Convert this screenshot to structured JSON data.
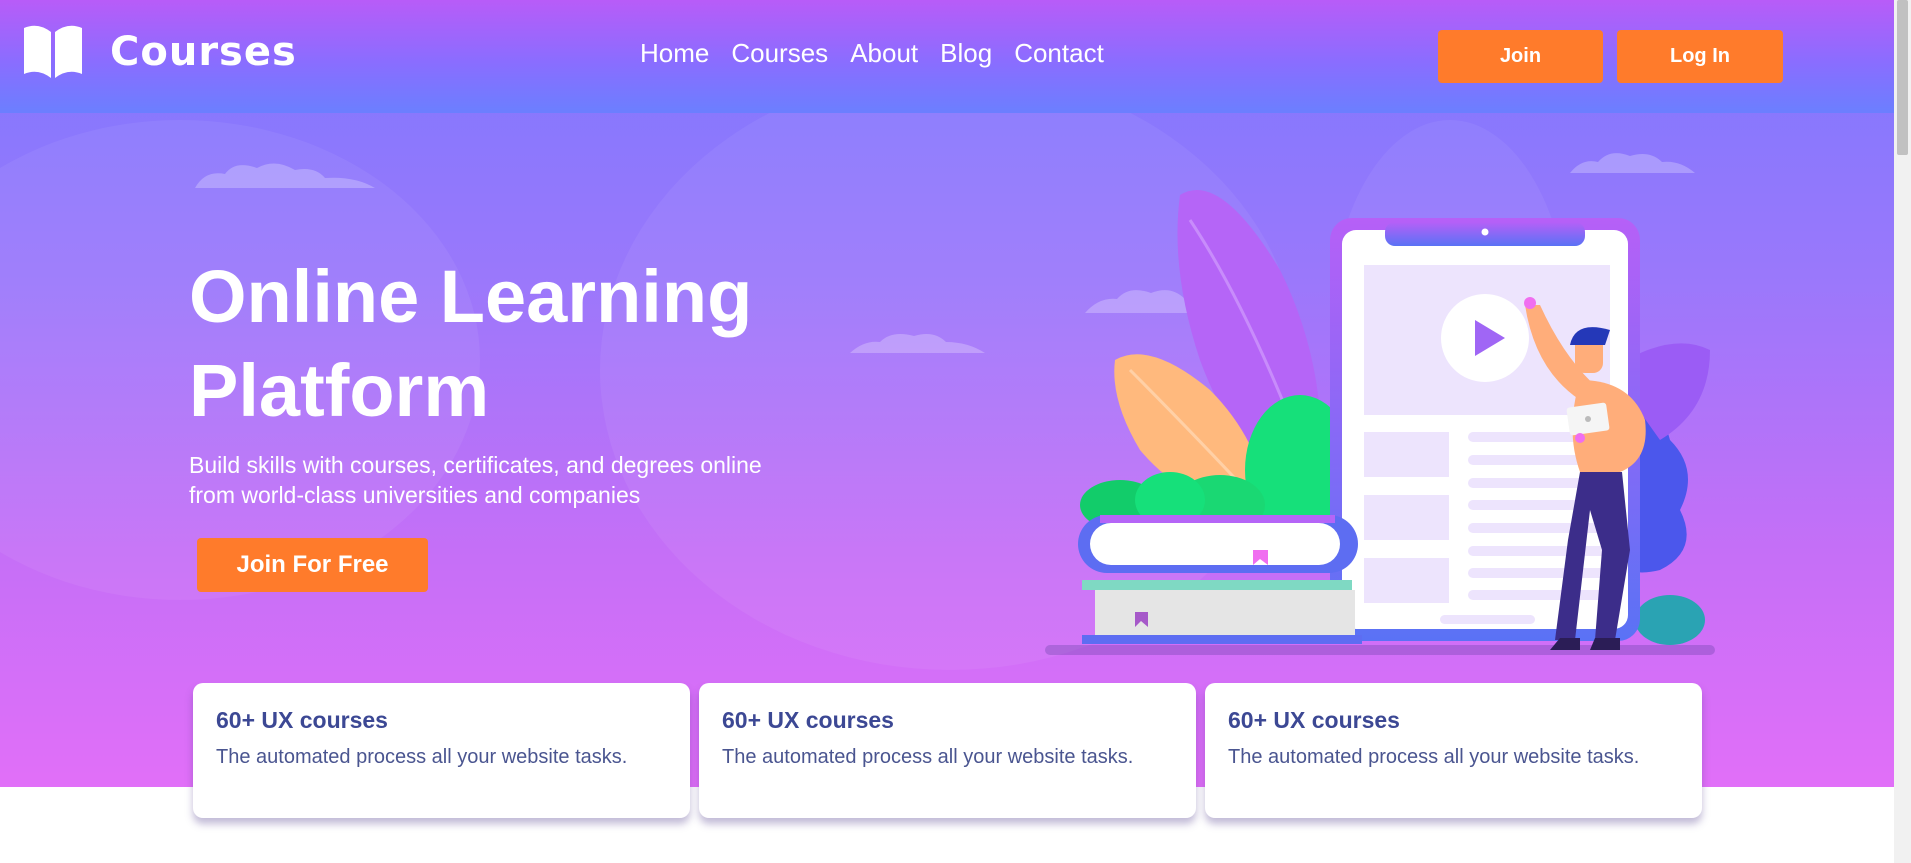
{
  "brand": {
    "name": "Courses",
    "logo_icon": "open-book-icon"
  },
  "nav": {
    "links": [
      "Home",
      "Courses",
      "About",
      "Blog",
      "Contact"
    ],
    "join_label": "Join",
    "login_label": "Log In"
  },
  "hero": {
    "title_line1": "Online Learning",
    "title_line2": "Platform",
    "subtitle": "Build skills with courses, certificates, and degrees online from world-class universities and companies",
    "cta_label": "Join For Free",
    "illustration_icons": [
      "tablet-icon",
      "play-icon",
      "books-icon",
      "person-icon",
      "laptop-icon",
      "leaf-icon",
      "cloud-icon"
    ]
  },
  "cards": [
    {
      "title": "60+ UX courses",
      "description": "The automated process all your website tasks."
    },
    {
      "title": "60+ UX courses",
      "description": "The automated process all your website tasks."
    },
    {
      "title": "60+ UX courses",
      "description": "The automated process all your website tasks."
    }
  ],
  "colors": {
    "accent": "#ff7b2b",
    "nav_top": "#b85cf8",
    "nav_bottom": "#6b7fff",
    "hero_top": "#7d77ff",
    "hero_bottom": "#e16ff8",
    "card_text": "#3c4894"
  }
}
